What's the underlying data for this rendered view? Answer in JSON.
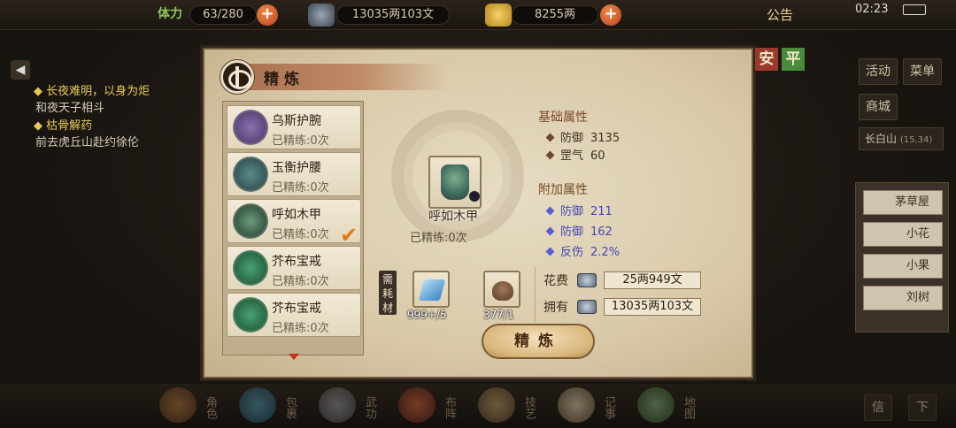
{
  "topbar": {
    "stamina_label": "体力",
    "stamina_value": "63/280",
    "silver_value": "13035两103文",
    "gold_value": "8255两",
    "notice_label": "公告",
    "clock": "02:23"
  },
  "quests": [
    {
      "title": "长夜难明，以身为炬",
      "desc": "和夜天子相斗"
    },
    {
      "title": "枯骨解药",
      "desc": "前去虎丘山赴约徐伦"
    }
  ],
  "side": {
    "buttons": [
      "活动",
      "菜单",
      "商城"
    ],
    "location": "长白山",
    "coords": "(15,34)",
    "npcs": [
      "茅草屋",
      "小花",
      "小果",
      "刘树"
    ]
  },
  "bottom_menu": [
    "角色",
    "包裹",
    "武功",
    "布阵",
    "技艺",
    "记事",
    "地图"
  ],
  "bottom_right": [
    "信",
    "下"
  ],
  "dialog": {
    "title": "精炼",
    "side_tabs": [
      "安",
      "平"
    ],
    "items": [
      {
        "name": "乌斯护腕",
        "refined": "已精练:0次"
      },
      {
        "name": "玉衡护腰",
        "refined": "已精练:0次"
      },
      {
        "name": "呼如木甲",
        "refined": "已精练:0次"
      },
      {
        "name": "芥布宝戒",
        "refined": "已精练:0次"
      },
      {
        "name": "芥布宝戒",
        "refined": "已精练:0次"
      }
    ],
    "selected": {
      "name": "呼如木甲",
      "refined": "已精练:0次"
    },
    "base_title": "基础属性",
    "base_attrs": [
      {
        "name": "防御",
        "value": "3135"
      },
      {
        "name": "罡气",
        "value": "60"
      }
    ],
    "add_title": "附加属性",
    "add_attrs": [
      {
        "name": "防御",
        "value": "211"
      },
      {
        "name": "防御",
        "value": "162"
      },
      {
        "name": "反伤",
        "value": "2.2%"
      }
    ],
    "material_label": "需耗材",
    "materials": [
      {
        "icon": "blue-gem-icon",
        "count": "999+/5"
      },
      {
        "icon": "bowl-icon",
        "count": "377/1"
      }
    ],
    "cost_label": "花费",
    "cost_value": "25两949文",
    "owned_label": "拥有",
    "owned_value": "13035两103文",
    "refine_button": "精炼"
  }
}
